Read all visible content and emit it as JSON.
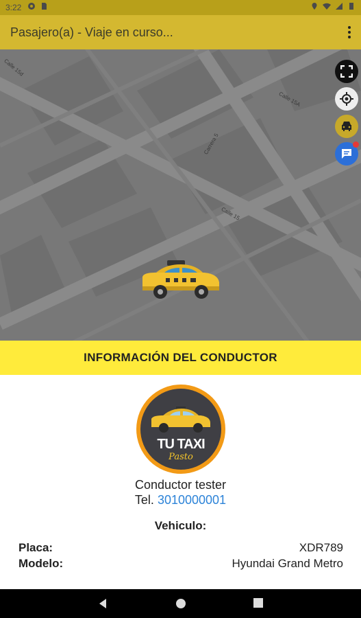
{
  "status_bar": {
    "time": "3:22"
  },
  "app_bar": {
    "title": "Pasajero(a) - Viaje en curso..."
  },
  "map": {
    "streets": [
      {
        "label": "Calle 15d"
      },
      {
        "label": "Calle 15A"
      },
      {
        "label": "Carrera 5"
      },
      {
        "label": "Calle 15"
      }
    ],
    "buttons": [
      "fullscreen-icon",
      "my-location-icon",
      "car-icon",
      "chat-icon"
    ]
  },
  "info": {
    "header": "INFORMACIÓN DEL CONDUCTOR",
    "logo_title": "TU TAXI",
    "logo_subtitle": "Pasto",
    "driver_name": "Conductor tester",
    "tel_label": "Tel.",
    "tel_number": "3010000001",
    "vehicle_title": "Vehiculo:",
    "fields": [
      {
        "label": "Placa:",
        "value": "XDR789"
      },
      {
        "label": "Modelo:",
        "value": "Hyundai Grand Metro"
      }
    ]
  },
  "colors": {
    "accent": "#ffeb3b",
    "app_bar": "#d4b830",
    "link": "#2c83d8"
  }
}
